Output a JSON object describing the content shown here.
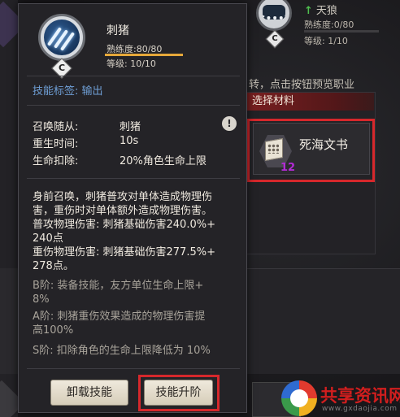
{
  "background": {
    "skill2": {
      "name": "天狼",
      "proficiency": "熟练度:0/80",
      "level": "等级: 1/10",
      "badge": "C"
    },
    "hint": "转，点击按钮预览职业",
    "materials": {
      "header": "选择材料",
      "item": {
        "name": "死海文书",
        "count": "12"
      }
    }
  },
  "tooltip": {
    "skill": {
      "name": "刺猪",
      "badge": "C",
      "proficiency": "熟练度:80/80",
      "proficiency_fraction": 1.0,
      "level": "等级: 10/10"
    },
    "tag_line": "技能标签: 输出",
    "stats": [
      {
        "label": "召唤随从:",
        "value": "刺猪"
      },
      {
        "label": "重生时间:",
        "value": "10s"
      },
      {
        "label": "生命扣除:",
        "value": "20%角色生命上限"
      }
    ],
    "info_glyph": "!",
    "description": [
      "身前召唤，刺猪普攻对单体造成物理伤",
      "害，重伤时对单体额外造成物理伤害。",
      "普攻物理伤害: 刺猪基础伤害240.0%+",
      "240点",
      "重伤物理伤害: 刺猪基础伤害277.5%+",
      "278点。"
    ],
    "stages": [
      "B阶: 装备技能，友方单位生命上限+",
      "8%",
      "A阶: 刺猪重伤效果造成的物理伤害提",
      "高100%",
      "S阶: 扣除角色的生命上限降低为 10%"
    ],
    "buttons": {
      "uninstall": "卸载技能",
      "upgrade": "技能升阶"
    }
  },
  "watermark": {
    "text": "共享资讯网",
    "url": "www.gxdaojia.com"
  },
  "colors": {
    "highlight": "#d6282c",
    "tag_blue": "#6f9fd6",
    "prof_bar": "#e6a83a",
    "count_purple": "#b32bd6"
  }
}
